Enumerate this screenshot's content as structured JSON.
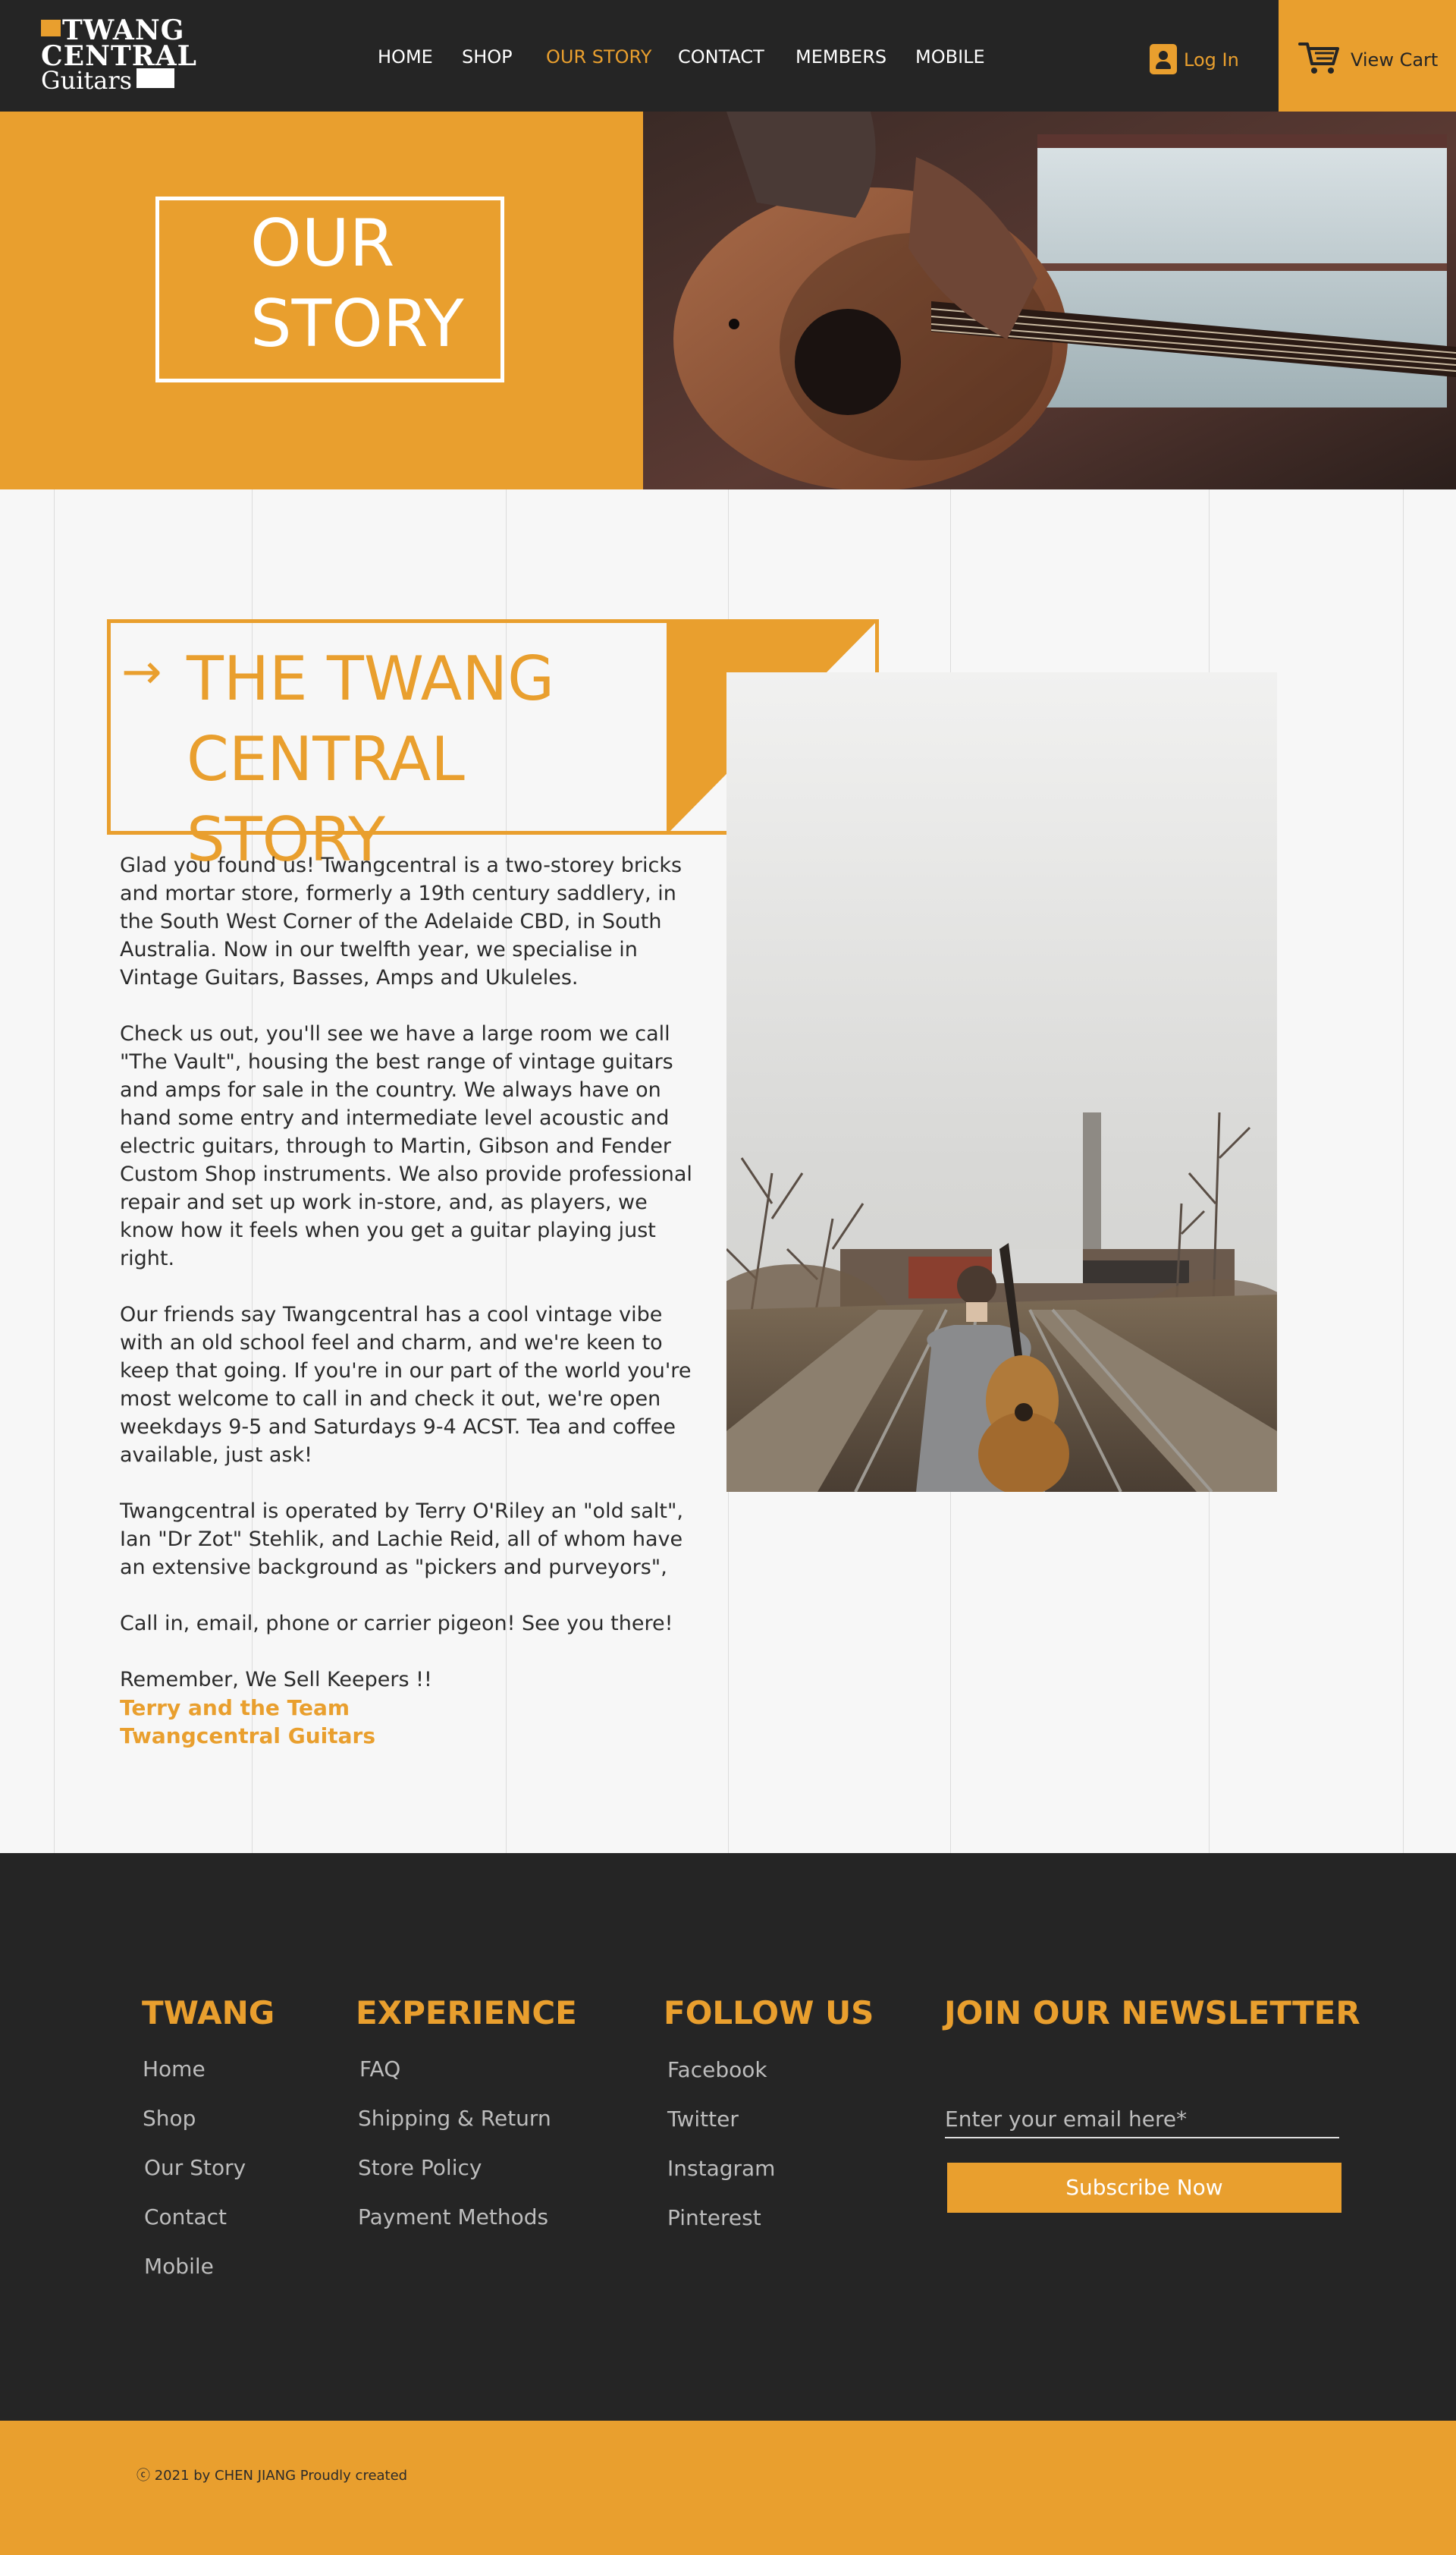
{
  "header": {
    "logo": {
      "line1": "TWANG",
      "line2": "CENTRAL",
      "line3": "Guitars"
    },
    "nav": [
      "HOME",
      "SHOP",
      "OUR STORY",
      "CONTACT",
      "MEMBERS",
      "MOBILE"
    ],
    "active_nav": "OUR STORY",
    "login_label": "Log In",
    "cart_label": "View Cart"
  },
  "hero": {
    "title_line1": "OUR",
    "title_line2": "STORY"
  },
  "story": {
    "arrow": "→",
    "title_line1": "THE TWANG",
    "title_line2": "CENTRAL STORY",
    "paragraphs": [
      "Glad you found us! Twangcentral is a two-storey bricks and mortar store, formerly a 19th century saddlery, in the South West Corner of the Adelaide CBD, in South Australia. Now in our twelfth year, we specialise in Vintage Guitars, Basses, Amps and Ukuleles.",
      "Check us out, you'll see we have a large room we call \"The Vault\", housing the best range of vintage guitars and amps for sale in the country.  We always have on hand some entry and intermediate level acoustic and electric guitars, through to Martin, Gibson and Fender Custom Shop instruments.  We also provide professional repair and set up work in-store, and, as players, we know how it feels when you get a guitar playing just right.",
      "Our friends say Twangcentral has a cool vintage vibe with an old school feel and charm, and we're keen to keep that going.  If you're in our part of the world you're most welcome to call in and check it out, we're open weekdays 9-5 and Saturdays 9-4 ACST.  Tea and coffee  available, just ask!",
      "Twangcentral is operated by Terry O'Riley an \"old salt\", Ian \"Dr Zot\" Stehlik, and Lachie Reid, all of whom have an extensive background  as \"pickers and purveyors\",",
      "Call in, email, phone or carrier pigeon! See you there!",
      "Remember, We Sell Keepers !!"
    ],
    "sign_line1": "Terry and the Team",
    "sign_line2": "Twangcentral Guitars"
  },
  "footer": {
    "col1": {
      "heading": "TWANG",
      "links": [
        "Home",
        "Shop",
        "Our Story",
        "Contact",
        "Mobile"
      ]
    },
    "col2": {
      "heading": "EXPERIENCE",
      "links": [
        "FAQ",
        "Shipping & Return",
        "Store Policy",
        "Payment Methods"
      ]
    },
    "col3": {
      "heading": "FOLLOW US",
      "links": [
        "Facebook",
        "Twitter",
        "Instagram",
        "Pinterest"
      ]
    },
    "newsletter": {
      "heading": "JOIN OUR NEWSLETTER",
      "placeholder": "Enter your email here*",
      "button": "Subscribe Now"
    },
    "copyright": "ⓒ 2021 by CHEN JIANG Proudly created"
  },
  "colors": {
    "accent": "#E99F2E",
    "dark": "#252525",
    "light_bg": "#f7f7f7"
  }
}
